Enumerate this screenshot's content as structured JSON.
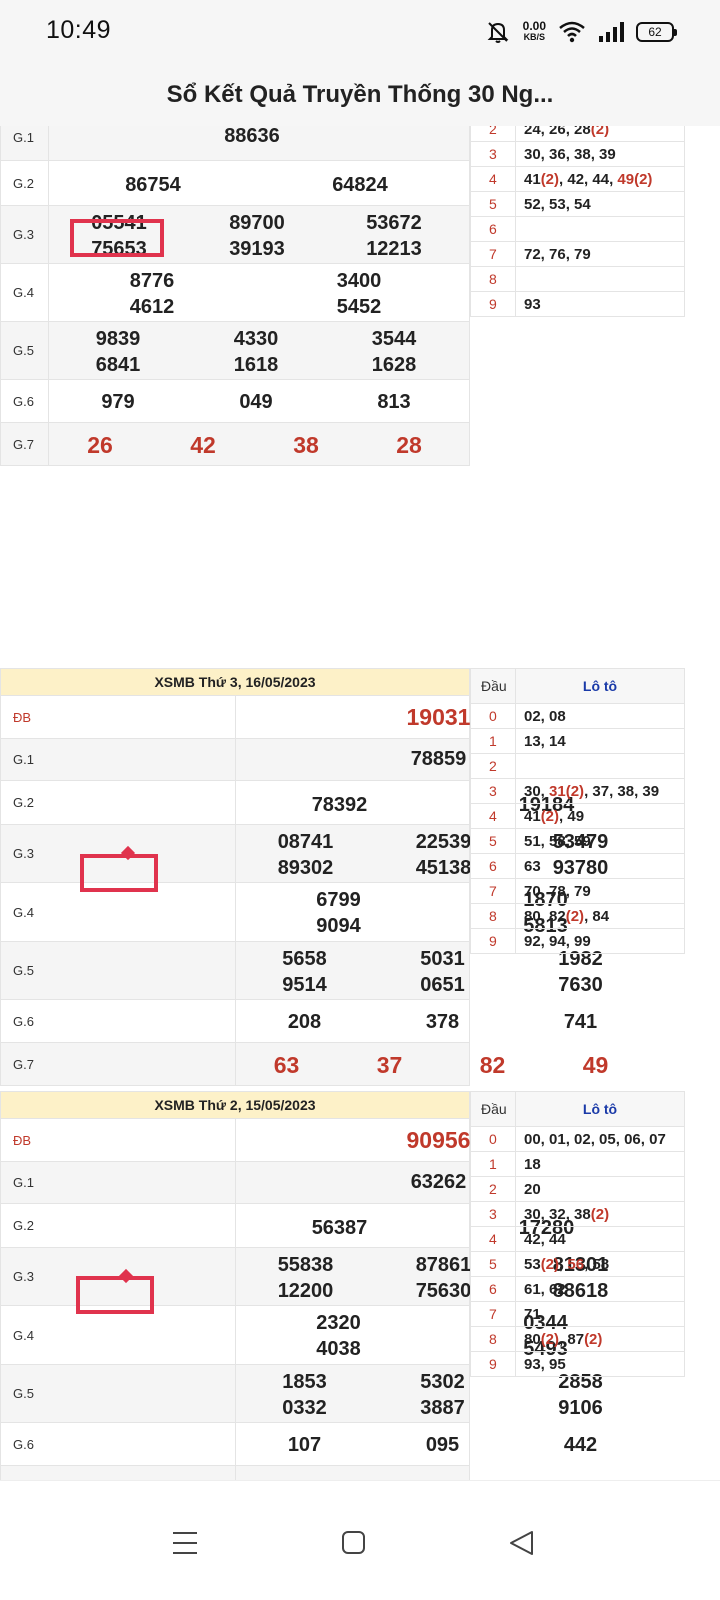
{
  "status_bar": {
    "time": "10:49",
    "net_speed": "0.00",
    "net_unit": "KB/S",
    "battery": "62"
  },
  "header": {
    "title": "Sổ Kết Quả Truyền Thống 30 Ng..."
  },
  "results": [
    {
      "caption": "",
      "rows": [
        {
          "label": "G.1",
          "values": [
            "88636"
          ]
        },
        {
          "label": "G.2",
          "values": [
            "86754",
            "64824"
          ]
        },
        {
          "label": "G.3",
          "values": [
            "05541",
            "89700",
            "53672",
            "75653",
            "39193",
            "12213"
          ]
        },
        {
          "label": "G.4",
          "values": [
            "8776",
            "3400",
            "4612",
            "5452"
          ]
        },
        {
          "label": "G.5",
          "values": [
            "9839",
            "4330",
            "3544",
            "6841",
            "1618",
            "1628"
          ]
        },
        {
          "label": "G.6",
          "values": [
            "979",
            "049",
            "813"
          ]
        },
        {
          "label": "G.7",
          "values": [
            "26",
            "42",
            "38",
            "28"
          ]
        }
      ],
      "loto_header": null,
      "loto": [
        {
          "d": "2",
          "v": [
            [
              "24, 26, 28",
              ""
            ],
            [
              "(2)",
              "r"
            ]
          ]
        },
        {
          "d": "3",
          "v": [
            [
              "30, 36, 38, 39",
              ""
            ]
          ]
        },
        {
          "d": "4",
          "v": [
            [
              "41",
              ""
            ],
            [
              "(2)",
              "r"
            ],
            [
              ", 42, 44, ",
              ""
            ],
            [
              "49",
              "r"
            ],
            [
              "(2)",
              "r"
            ]
          ]
        },
        {
          "d": "5",
          "v": [
            [
              "52, 53, 54",
              ""
            ]
          ]
        },
        {
          "d": "6",
          "v": []
        },
        {
          "d": "7",
          "v": [
            [
              "72, 76, 79",
              ""
            ]
          ]
        },
        {
          "d": "8",
          "v": []
        },
        {
          "d": "9",
          "v": [
            [
              "93",
              ""
            ]
          ]
        }
      ]
    },
    {
      "caption": "XSMB Thứ 3, 16/05/2023",
      "rows": [
        {
          "label": "ĐB",
          "values": [
            "19031"
          ]
        },
        {
          "label": "G.1",
          "values": [
            "78859"
          ]
        },
        {
          "label": "G.2",
          "values": [
            "78392",
            "19184"
          ]
        },
        {
          "label": "G.3",
          "values": [
            "08741",
            "22539",
            "53479",
            "89302",
            "45138",
            "93780"
          ]
        },
        {
          "label": "G.4",
          "values": [
            "6799",
            "1870",
            "9094",
            "5813"
          ]
        },
        {
          "label": "G.5",
          "values": [
            "5658",
            "5031",
            "1982",
            "9514",
            "0651",
            "7630"
          ]
        },
        {
          "label": "G.6",
          "values": [
            "208",
            "378",
            "741"
          ]
        },
        {
          "label": "G.7",
          "values": [
            "63",
            "37",
            "82",
            "49"
          ]
        }
      ],
      "loto_header": {
        "dau": "Đầu",
        "loto": "Lô tô"
      },
      "loto": [
        {
          "d": "0",
          "v": [
            [
              "02, 08",
              ""
            ]
          ]
        },
        {
          "d": "1",
          "v": [
            [
              "13, 14",
              ""
            ]
          ]
        },
        {
          "d": "2",
          "v": []
        },
        {
          "d": "3",
          "v": [
            [
              "30, ",
              ""
            ],
            [
              "31",
              "r"
            ],
            [
              "(2)",
              "r"
            ],
            [
              ", 37, 38, 39",
              ""
            ]
          ]
        },
        {
          "d": "4",
          "v": [
            [
              "41",
              ""
            ],
            [
              "(2)",
              "r"
            ],
            [
              ", 49",
              ""
            ]
          ]
        },
        {
          "d": "5",
          "v": [
            [
              "51, 58, 59",
              ""
            ]
          ]
        },
        {
          "d": "6",
          "v": [
            [
              "63",
              ""
            ]
          ]
        },
        {
          "d": "7",
          "v": [
            [
              "70, 78, 79",
              ""
            ]
          ]
        },
        {
          "d": "8",
          "v": [
            [
              "80, 82",
              ""
            ],
            [
              "(2)",
              "r"
            ],
            [
              ", 84",
              ""
            ]
          ]
        },
        {
          "d": "9",
          "v": [
            [
              "92, 94, 99",
              ""
            ]
          ]
        }
      ]
    },
    {
      "caption": "XSMB Thứ 2, 15/05/2023",
      "rows": [
        {
          "label": "ĐB",
          "values": [
            "90956"
          ]
        },
        {
          "label": "G.1",
          "values": [
            "63262"
          ]
        },
        {
          "label": "G.2",
          "values": [
            "56387",
            "17280"
          ]
        },
        {
          "label": "G.3",
          "values": [
            "55838",
            "87861",
            "81301",
            "12200",
            "75630",
            "88618"
          ]
        },
        {
          "label": "G.4",
          "values": [
            "2320",
            "0344",
            "4038",
            "5493"
          ]
        },
        {
          "label": "G.5",
          "values": [
            "1853",
            "5302",
            "2858",
            "0332",
            "3887",
            "9106"
          ]
        },
        {
          "label": "G.6",
          "values": [
            "107",
            "095",
            "442"
          ]
        }
      ],
      "loto_header": {
        "dau": "Đầu",
        "loto": "Lô tô"
      },
      "loto": [
        {
          "d": "0",
          "v": [
            [
              "00, 01, 02, 05, 06, 07",
              ""
            ]
          ]
        },
        {
          "d": "1",
          "v": [
            [
              "18",
              ""
            ]
          ]
        },
        {
          "d": "2",
          "v": [
            [
              "20",
              ""
            ]
          ]
        },
        {
          "d": "3",
          "v": [
            [
              "30, 32, 38",
              ""
            ],
            [
              "(2)",
              "r"
            ]
          ]
        },
        {
          "d": "4",
          "v": [
            [
              "42, 44",
              ""
            ]
          ]
        },
        {
          "d": "5",
          "v": [
            [
              "53",
              ""
            ],
            [
              "(2)",
              "r"
            ],
            [
              ", ",
              ""
            ],
            [
              "56",
              "r"
            ],
            [
              ", 58",
              ""
            ]
          ]
        },
        {
          "d": "6",
          "v": [
            [
              "61, 62",
              ""
            ]
          ]
        },
        {
          "d": "7",
          "v": [
            [
              "71",
              ""
            ]
          ]
        },
        {
          "d": "8",
          "v": [
            [
              "80",
              ""
            ],
            [
              "(2)",
              "r"
            ],
            [
              ", 87",
              ""
            ],
            [
              "(2)",
              "r"
            ]
          ]
        },
        {
          "d": "9",
          "v": [
            [
              "93, 95",
              ""
            ]
          ]
        }
      ]
    }
  ],
  "nav_bar": {
    "items": [
      "menu",
      "home",
      "back"
    ]
  },
  "colors": {
    "accent_red": "#c0392b",
    "caption_bg": "#fdf1c8",
    "marker": "#e0334d",
    "loto_header": "#1a3aa8"
  }
}
